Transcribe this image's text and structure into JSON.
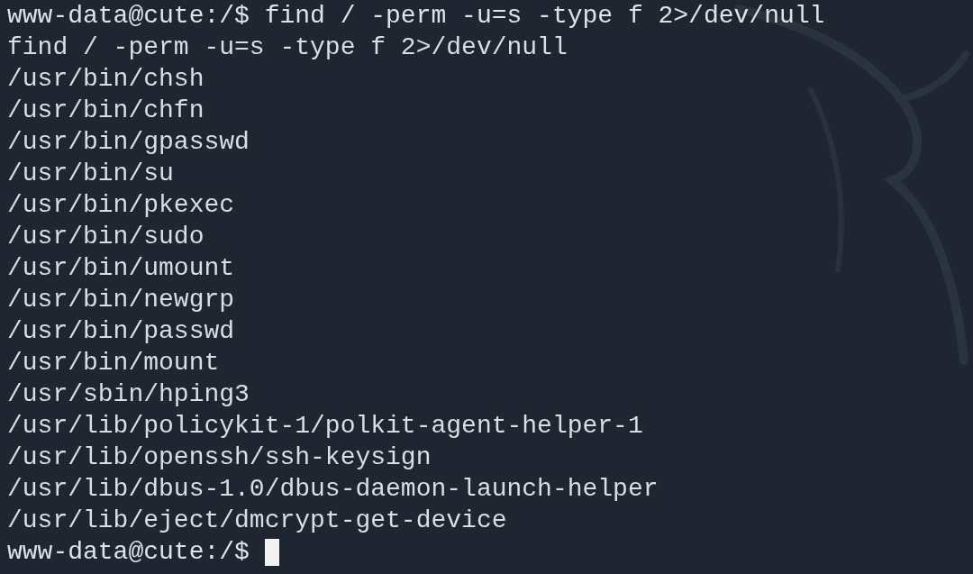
{
  "terminal": {
    "lines": [
      {
        "kind": "prompt",
        "text": "www-data@cute:/$ find / -perm -u=s -type f 2>/dev/null"
      },
      {
        "kind": "output",
        "text": "find / -perm -u=s -type f 2>/dev/null"
      },
      {
        "kind": "output",
        "text": "/usr/bin/chsh"
      },
      {
        "kind": "output",
        "text": "/usr/bin/chfn"
      },
      {
        "kind": "output",
        "text": "/usr/bin/gpasswd"
      },
      {
        "kind": "output",
        "text": "/usr/bin/su"
      },
      {
        "kind": "output",
        "text": "/usr/bin/pkexec"
      },
      {
        "kind": "output",
        "text": "/usr/bin/sudo"
      },
      {
        "kind": "output",
        "text": "/usr/bin/umount"
      },
      {
        "kind": "output",
        "text": "/usr/bin/newgrp"
      },
      {
        "kind": "output",
        "text": "/usr/bin/passwd"
      },
      {
        "kind": "output",
        "text": "/usr/bin/mount"
      },
      {
        "kind": "output",
        "text": "/usr/sbin/hping3"
      },
      {
        "kind": "output",
        "text": "/usr/lib/policykit-1/polkit-agent-helper-1"
      },
      {
        "kind": "output",
        "text": "/usr/lib/openssh/ssh-keysign"
      },
      {
        "kind": "output",
        "text": "/usr/lib/dbus-1.0/dbus-daemon-launch-helper"
      },
      {
        "kind": "output",
        "text": "/usr/lib/eject/dmcrypt-get-device"
      },
      {
        "kind": "prompt",
        "text": "www-data@cute:/$",
        "cursor": true
      }
    ]
  }
}
